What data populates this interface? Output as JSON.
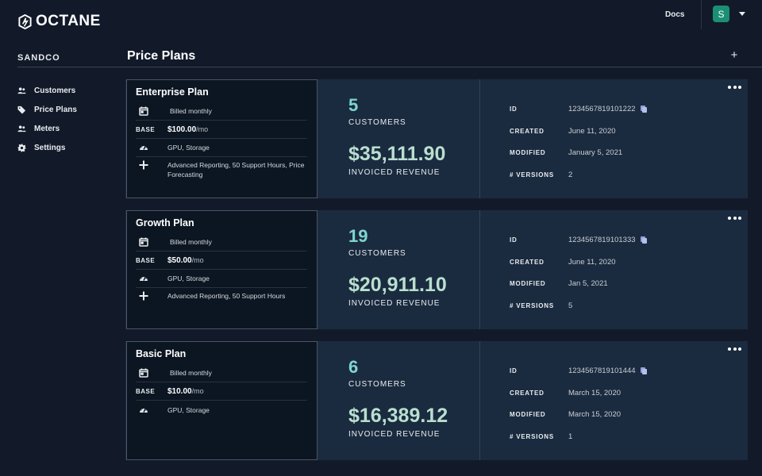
{
  "app": {
    "logo_text": "OCTANE"
  },
  "topbar": {
    "docs_label": "Docs",
    "avatar_initial": "S"
  },
  "sidebar": {
    "org_name": "SANDCO",
    "items": [
      {
        "label": "Customers",
        "icon": "users-icon"
      },
      {
        "label": "Price Plans",
        "icon": "tag-icon"
      },
      {
        "label": "Meters",
        "icon": "users-icon"
      },
      {
        "label": "Settings",
        "icon": "gear-icon"
      }
    ]
  },
  "page": {
    "title": "Price Plans",
    "add_label": "+"
  },
  "labels": {
    "base": "BASE",
    "customers": "CUSTOMERS",
    "invoiced_revenue": "INVOICED REVENUE",
    "id": "ID",
    "created": "CREATED",
    "modified": "MODIFIED",
    "versions": "# VERSIONS"
  },
  "plans": [
    {
      "name": "Enterprise Plan",
      "billing": "Billed monthly",
      "base_price": "$100.00",
      "base_unit": "/mo",
      "meters": "GPU, Storage",
      "addons": "Advanced Reporting, 50 Support Hours, Price Forecasting",
      "customers": "5",
      "revenue": "$35,111.90",
      "id": "1234567819101222",
      "created": "June 11, 2020",
      "modified": "January 5, 2021",
      "versions": "2"
    },
    {
      "name": "Growth Plan",
      "billing": "Billed monthly",
      "base_price": "$50.00",
      "base_unit": "/mo",
      "meters": "GPU, Storage",
      "addons": "Advanced Reporting, 50 Support Hours",
      "customers": "19",
      "revenue": "$20,911.10",
      "id": "1234567819101333",
      "created": "June 11, 2020",
      "modified": "Jan 5, 2021",
      "versions": "5"
    },
    {
      "name": "Basic Plan",
      "billing": "Billed monthly",
      "base_price": "$10.00",
      "base_unit": "/mo",
      "meters": "GPU, Storage",
      "addons": "",
      "customers": "6",
      "revenue": "$16,389.12",
      "id": "1234567819101444",
      "created": "March 15, 2020",
      "modified": "March 15, 2020",
      "versions": "1"
    }
  ]
}
